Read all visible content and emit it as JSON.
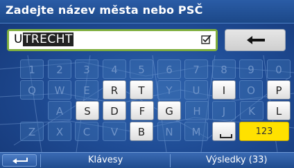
{
  "header": {
    "title": "Zadejte název města nebo PSČ"
  },
  "search": {
    "value_first_char": "U",
    "value_rest": "TRECHT"
  },
  "keyboard": {
    "row1": [
      {
        "label": "1",
        "enabled": false
      },
      {
        "label": "2",
        "enabled": false
      },
      {
        "label": "3",
        "enabled": false
      },
      {
        "label": "4",
        "enabled": false
      },
      {
        "label": "5",
        "enabled": false
      },
      {
        "label": "6",
        "enabled": false
      },
      {
        "label": "7",
        "enabled": false
      },
      {
        "label": "8",
        "enabled": false
      },
      {
        "label": "9",
        "enabled": false
      },
      {
        "label": "0",
        "enabled": false
      }
    ],
    "row2": [
      {
        "label": "Q",
        "enabled": false
      },
      {
        "label": "W",
        "enabled": false
      },
      {
        "label": "E",
        "enabled": false
      },
      {
        "label": "R",
        "enabled": true
      },
      {
        "label": "T",
        "enabled": true
      },
      {
        "label": "Y",
        "enabled": false
      },
      {
        "label": "U",
        "enabled": false
      },
      {
        "label": "I",
        "enabled": true
      },
      {
        "label": "O",
        "enabled": false
      },
      {
        "label": "P",
        "enabled": true
      }
    ],
    "row3": [
      {
        "label": "A",
        "enabled": false
      },
      {
        "label": "S",
        "enabled": true
      },
      {
        "label": "D",
        "enabled": true
      },
      {
        "label": "F",
        "enabled": true
      },
      {
        "label": "G",
        "enabled": true
      },
      {
        "label": "H",
        "enabled": false
      },
      {
        "label": "J",
        "enabled": false
      },
      {
        "label": "K",
        "enabled": false
      },
      {
        "label": "L",
        "enabled": true
      }
    ],
    "row4": [
      {
        "label": "Z",
        "enabled": false
      },
      {
        "label": "X",
        "enabled": false
      },
      {
        "label": "C",
        "enabled": false
      },
      {
        "label": "V",
        "enabled": false
      },
      {
        "label": "B",
        "enabled": true
      },
      {
        "label": "N",
        "enabled": false
      },
      {
        "label": "M",
        "enabled": false
      }
    ],
    "numbers_key": "123"
  },
  "bottom": {
    "keys_label": "Klávesy",
    "results_label": "Výsledky (33)"
  },
  "colors": {
    "accent": "#ffe100",
    "input_border": "#7fae3e",
    "title_bg": "#1c4888"
  }
}
